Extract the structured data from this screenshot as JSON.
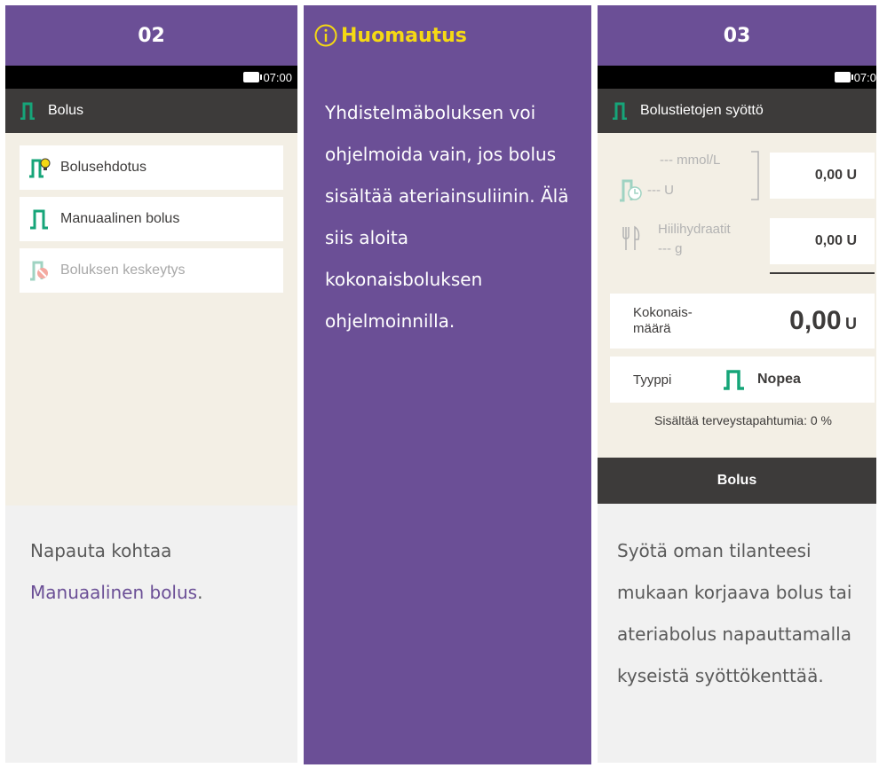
{
  "steps": {
    "left": {
      "number": "02",
      "status_time": "07:00",
      "title": "Bolus",
      "menu": [
        {
          "label": "Bolusehdotus"
        },
        {
          "label": "Manuaalinen bolus"
        },
        {
          "label": "Boluksen keskeytys"
        }
      ],
      "desc_prefix": "Napauta kohtaa ",
      "desc_link": "Manuaalinen bolus",
      "desc_suffix": "."
    },
    "note": {
      "title": "Huomautus",
      "body": "Yhdistelmäboluksen voi ohjelmoida vain, jos bolus sisältää ateriainsuliinin. Älä siis aloita kokonaisboluksen ohjelmoinnilla."
    },
    "right": {
      "number": "03",
      "status_time": "07:0",
      "title": "Bolustietojen syöttö",
      "bg_unit": "--- mmol/L",
      "insulin_unit": "--- U",
      "correction_value": "0,00 U",
      "carb_label": "Hiilihydraatit",
      "carb_unit": "--- g",
      "carb_value": "0,00 U",
      "total_label_1": "Kokonais-",
      "total_label_2": "määrä",
      "total_value": "0,00",
      "total_unit": "U",
      "type_label": "Tyyppi",
      "type_value": "Nopea",
      "health_events": "Sisältää terveystapahtumia: 0 %",
      "bolus_button": "Bolus",
      "desc": "Syötä oman tilanteesi mukaan korjaava bolus tai ateriabolus napauttamalla kyseistä syöttökenttää."
    }
  },
  "colors": {
    "purple": "#6b4f96",
    "yellow": "#f5d914",
    "teal": "#16a579",
    "dark_bar": "#3d3b3a",
    "screen_bg": "#f3efe5"
  }
}
